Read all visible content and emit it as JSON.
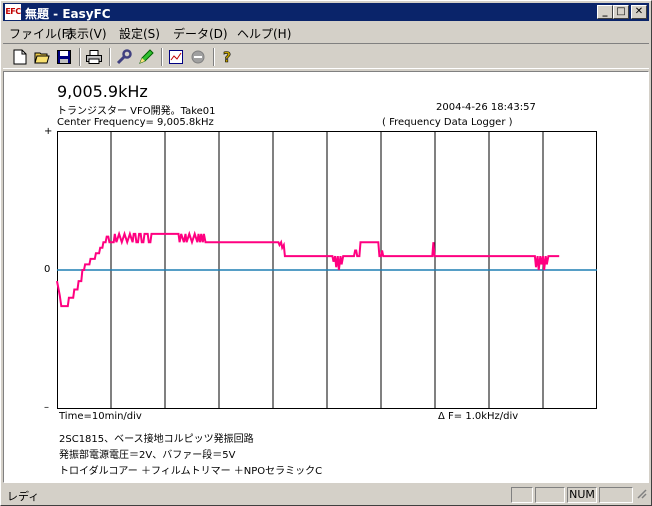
{
  "window": {
    "app_icon": "EFC",
    "title": "無題 - EasyFC",
    "minimize": "_",
    "maximize": "□",
    "close": "✕"
  },
  "menu": [
    {
      "label": "ファイル(F)"
    },
    {
      "label": "表示(V)"
    },
    {
      "label": "設定(S)"
    },
    {
      "label": "データ(D)"
    },
    {
      "label": "ヘルプ(H)"
    }
  ],
  "toolbar": {
    "icons": [
      "new-file-icon",
      "open-folder-icon",
      "save-disk-icon",
      "print-icon",
      "wrench-icon",
      "pen-icon",
      "chart-window-icon",
      "stop-circle-icon",
      "help-question-icon"
    ]
  },
  "display": {
    "frequency": "9,005.9kHz",
    "memo": "トランジスター VFO開発。Take01",
    "timestamp": "2004-4-26  18:43:57",
    "center_frequency": "Center Frequency=   9,005.8kHz",
    "mode": "( Frequency Data Logger )",
    "plus_label": "+",
    "zero_label": "0",
    "minus_label": "–",
    "time_div": "Time=10min/div",
    "freq_div": "Δ F=    1.0kHz/div",
    "notes": [
      "2SC1815、ベース接地コルピッツ発振回路",
      "発振部電源電圧＝2V、バファー段＝5V",
      "トロイダルコアー ＋フィルムトリマー ＋NPOセラミックC"
    ]
  },
  "chart_data": {
    "type": "line",
    "title": "",
    "xlabel": "Time=10min/div",
    "ylabel": "Δ F=    1.0kHz/div",
    "x_unit": "div (10 min)",
    "y_unit": "div (1.0 kHz)",
    "xlim": [
      0,
      10
    ],
    "ylim": [
      -5,
      5
    ],
    "baseline_color": "#1f7fb4",
    "grid_color": "#000000",
    "series": [
      {
        "color": "#ff0080",
        "points": [
          [
            0.0,
            -0.4
          ],
          [
            0.05,
            -0.9
          ],
          [
            0.08,
            -1.3
          ],
          [
            0.2,
            -1.3
          ],
          [
            0.22,
            -1.0
          ],
          [
            0.3,
            -1.0
          ],
          [
            0.32,
            -0.7
          ],
          [
            0.38,
            -0.7
          ],
          [
            0.4,
            -0.4
          ],
          [
            0.45,
            -0.4
          ],
          [
            0.47,
            0.0
          ],
          [
            0.5,
            0.0
          ],
          [
            0.52,
            0.2
          ],
          [
            0.6,
            0.2
          ],
          [
            0.62,
            0.4
          ],
          [
            0.7,
            0.4
          ],
          [
            0.72,
            0.6
          ],
          [
            0.78,
            0.6
          ],
          [
            0.8,
            0.8
          ],
          [
            0.84,
            0.8
          ],
          [
            0.86,
            1.0
          ],
          [
            0.9,
            1.0
          ],
          [
            0.92,
            1.2
          ],
          [
            0.95,
            1.2
          ],
          [
            0.97,
            1.0
          ],
          [
            1.05,
            1.0
          ],
          [
            1.07,
            1.3
          ],
          [
            1.1,
            1.0
          ],
          [
            1.15,
            1.3
          ],
          [
            1.2,
            1.0
          ],
          [
            1.25,
            1.3
          ],
          [
            1.3,
            1.0
          ],
          [
            1.35,
            1.3
          ],
          [
            1.4,
            1.0
          ],
          [
            1.42,
            1.3
          ],
          [
            1.45,
            1.3
          ],
          [
            1.47,
            1.0
          ],
          [
            1.5,
            1.0
          ],
          [
            1.52,
            1.3
          ],
          [
            1.55,
            1.3
          ],
          [
            1.57,
            1.0
          ],
          [
            1.6,
            1.0
          ],
          [
            1.62,
            1.3
          ],
          [
            1.68,
            1.3
          ],
          [
            1.7,
            1.0
          ],
          [
            1.73,
            1.0
          ],
          [
            1.75,
            1.3
          ],
          [
            1.78,
            1.3
          ],
          [
            1.8,
            1.3
          ],
          [
            1.9,
            1.3
          ],
          [
            2.1,
            1.3
          ],
          [
            2.2,
            1.3
          ],
          [
            2.25,
            1.3
          ],
          [
            2.27,
            1.0
          ],
          [
            2.3,
            1.3
          ],
          [
            2.35,
            1.0
          ],
          [
            2.38,
            1.3
          ],
          [
            2.4,
            1.0
          ],
          [
            2.45,
            1.3
          ],
          [
            2.5,
            1.0
          ],
          [
            2.55,
            1.3
          ],
          [
            2.6,
            1.0
          ],
          [
            2.62,
            1.3
          ],
          [
            2.65,
            1.0
          ],
          [
            2.67,
            1.3
          ],
          [
            2.7,
            1.0
          ],
          [
            2.72,
            1.3
          ],
          [
            2.75,
            1.0
          ],
          [
            2.8,
            1.0
          ],
          [
            3.0,
            1.0
          ],
          [
            4.0,
            1.0
          ],
          [
            4.05,
            1.0
          ],
          [
            4.1,
            1.0
          ],
          [
            4.12,
            0.9
          ],
          [
            4.15,
            1.0
          ],
          [
            4.17,
            0.8
          ],
          [
            4.2,
            0.9
          ],
          [
            4.22,
            0.5
          ],
          [
            4.8,
            0.5
          ],
          [
            5.1,
            0.5
          ],
          [
            5.12,
            0.3
          ],
          [
            5.15,
            0.5
          ],
          [
            5.17,
            0.1
          ],
          [
            5.2,
            0.5
          ],
          [
            5.22,
            0.0
          ],
          [
            5.25,
            0.5
          ],
          [
            5.27,
            0.2
          ],
          [
            5.3,
            0.5
          ],
          [
            5.5,
            0.5
          ],
          [
            5.52,
            0.7
          ],
          [
            5.54,
            0.7
          ],
          [
            5.56,
            0.5
          ],
          [
            5.6,
            0.5
          ],
          [
            5.62,
            1.0
          ],
          [
            5.95,
            1.0
          ],
          [
            5.97,
            0.5
          ],
          [
            6.0,
            0.5
          ],
          [
            6.02,
            0.7
          ],
          [
            6.04,
            0.5
          ],
          [
            6.1,
            0.5
          ],
          [
            6.4,
            0.5
          ],
          [
            6.95,
            0.5
          ],
          [
            6.97,
            1.0
          ],
          [
            6.99,
            0.5
          ],
          [
            7.2,
            0.5
          ],
          [
            8.0,
            0.5
          ],
          [
            8.8,
            0.5
          ],
          [
            8.85,
            0.5
          ],
          [
            8.87,
            0.1
          ],
          [
            8.9,
            0.5
          ],
          [
            8.92,
            0.0
          ],
          [
            8.95,
            0.5
          ],
          [
            8.97,
            0.2
          ],
          [
            9.0,
            0.5
          ],
          [
            9.02,
            0.0
          ],
          [
            9.05,
            0.5
          ],
          [
            9.07,
            0.2
          ],
          [
            9.1,
            0.5
          ],
          [
            9.3,
            0.5
          ]
        ]
      }
    ]
  },
  "status": {
    "text": "レディ",
    "num": "NUM"
  }
}
